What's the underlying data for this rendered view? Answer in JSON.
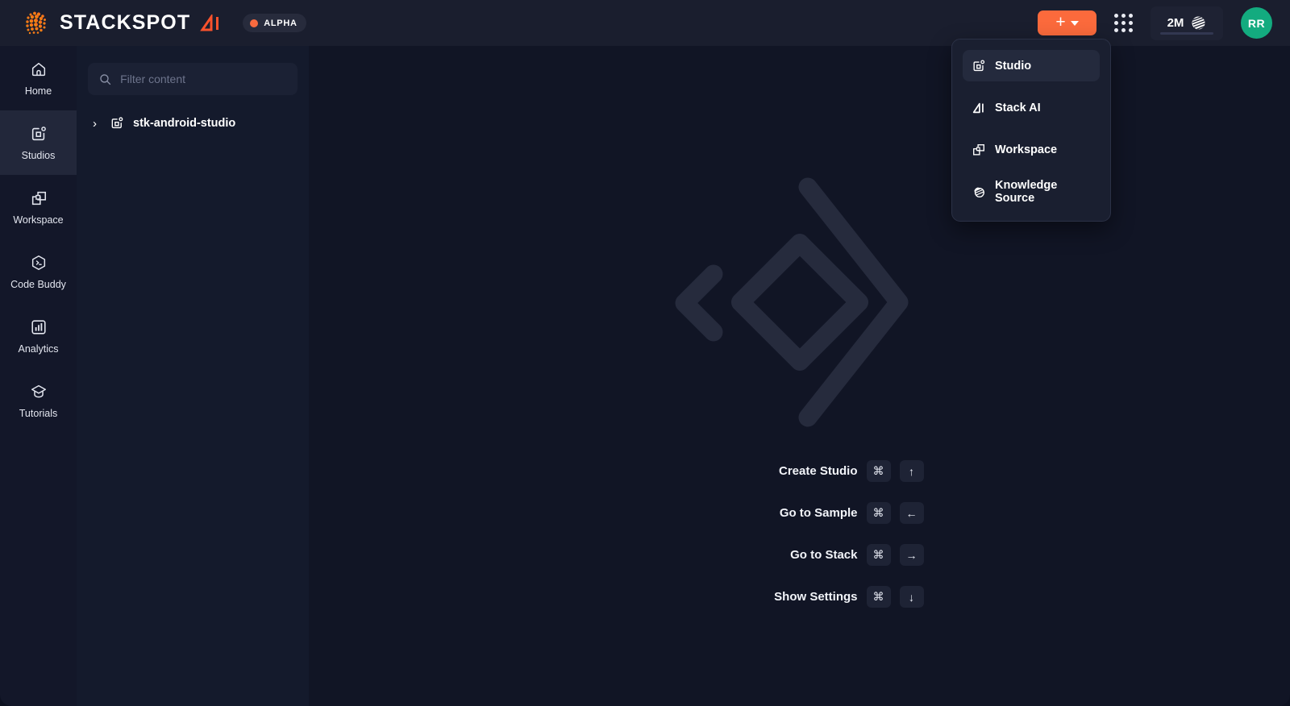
{
  "brand": {
    "logo_icon": "stackspot-dots-logo",
    "name": "STACKSPOT",
    "ai_suffix": "AI",
    "badge": "ALPHA",
    "badge_dot_color": "#f96b3f"
  },
  "topbar": {
    "create_button": {
      "icon": "plus-icon",
      "caret": "chevron-down-icon",
      "color": "#fb6a3c"
    },
    "apps_grid_icon": "grid-apps-icon",
    "usage": {
      "value": "2M",
      "icon": "credits-icon"
    },
    "avatar": {
      "initials": "RR",
      "color": "#13ab7f"
    }
  },
  "create_menu": {
    "items": [
      {
        "label": "Studio",
        "icon": "studio-icon",
        "active": true
      },
      {
        "label": "Stack AI",
        "icon": "stack-ai-icon",
        "active": false
      },
      {
        "label": "Workspace",
        "icon": "workspace-icon",
        "active": false
      },
      {
        "label": "Knowledge Source",
        "icon": "knowledge-source-icon",
        "active": false
      }
    ]
  },
  "sidebar": {
    "items": [
      {
        "label": "Home",
        "icon": "home-icon",
        "active": false
      },
      {
        "label": "Studios",
        "icon": "studio-icon",
        "active": true
      },
      {
        "label": "Workspace",
        "icon": "workspace-icon",
        "active": false
      },
      {
        "label": "Code Buddy",
        "icon": "code-buddy-hexagon-icon",
        "active": false
      },
      {
        "label": "Analytics",
        "icon": "analytics-bar-chart-icon",
        "active": false
      },
      {
        "label": "Tutorials",
        "icon": "graduation-cap-icon",
        "active": false
      }
    ]
  },
  "filter_panel": {
    "search": {
      "placeholder": "Filter content",
      "value": "",
      "icon": "search-icon"
    },
    "tree": [
      {
        "label": "stk-android-studio",
        "icon": "studio-icon",
        "chevron": "chevron-right-icon",
        "expanded": false
      }
    ]
  },
  "main": {
    "watermark_icon": "code-brackets-diamond-watermark",
    "shortcuts": [
      {
        "label": "Create Studio",
        "keys": [
          "⌘",
          "↑"
        ]
      },
      {
        "label": "Go to Sample",
        "keys": [
          "⌘",
          "←"
        ]
      },
      {
        "label": "Go to Stack",
        "keys": [
          "⌘",
          "→"
        ]
      },
      {
        "label": "Show Settings",
        "keys": [
          "⌘",
          "↓"
        ]
      }
    ]
  }
}
